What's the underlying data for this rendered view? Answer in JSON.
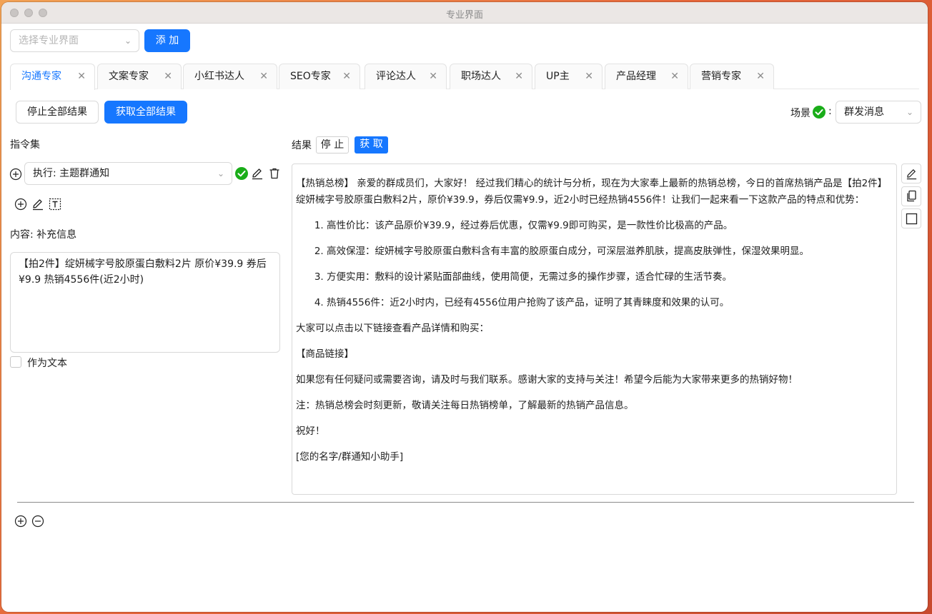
{
  "window": {
    "title": "专业界面"
  },
  "toolbar": {
    "select_placeholder": "选择专业界面",
    "add_label": "添 加"
  },
  "tabs": [
    {
      "label": "沟通专家"
    },
    {
      "label": "文案专家"
    },
    {
      "label": "小红书达人"
    },
    {
      "label": "SEO专家"
    },
    {
      "label": "评论达人"
    },
    {
      "label": "职场达人"
    },
    {
      "label": "UP主"
    },
    {
      "label": "产品经理"
    },
    {
      "label": "营销专家"
    }
  ],
  "actions": {
    "stop_all": "停止全部结果",
    "get_all": "获取全部结果",
    "scene_label": "场景",
    "scene_colon": ":",
    "scene_value": "群发消息"
  },
  "commands": {
    "title": "指令集",
    "select_value": "执行: 主题群通知",
    "content_label": "内容: 补充信息",
    "content_value": "【拍2件】绽妍械字号胶原蛋白敷料2片 原价¥39.9 券后¥9.9 热销4556件(近2小时)",
    "as_text_label": "作为文本"
  },
  "result": {
    "label": "结果",
    "stop": "停 止",
    "fetch": "获 取",
    "intro": "【热销总榜】 亲爱的群成员们，大家好！ 经过我们精心的统计与分析，现在为大家奉上最新的热销总榜，今日的首席热销产品是【拍2件】绽妍械字号胶原蛋白敷料2片，原价¥39.9，券后仅需¥9.9，近2小时已经热销4556件！让我们一起来看一下这款产品的特点和优势：",
    "points": [
      "高性价比：该产品原价¥39.9，经过券后优惠，仅需¥9.9即可购买，是一款性价比极高的产品。",
      "高效保湿：绽妍械字号胶原蛋白敷料含有丰富的胶原蛋白成分，可深层滋养肌肤，提高皮肤弹性，保湿效果明显。",
      "方便实用：敷料的设计紧贴面部曲线，使用简便，无需过多的操作步骤，适合忙碌的生活节奏。",
      "热销4556件：近2小时内，已经有4556位用户抢购了该产品，证明了其青睐度和效果的认可。"
    ],
    "p1": "大家可以点击以下链接查看产品详情和购买：",
    "p2": "【商品链接】",
    "p3": "如果您有任何疑问或需要咨询，请及时与我们联系。感谢大家的支持与关注！希望今后能为大家带来更多的热销好物！",
    "p4": "注：热销总榜会时刻更新，敬请关注每日热销榜单，了解最新的热销产品信息。",
    "p5": "祝好！",
    "p6": "[您的名字/群通知小助手]"
  },
  "colors": {
    "primary": "#1677ff",
    "success": "#1aad19"
  }
}
